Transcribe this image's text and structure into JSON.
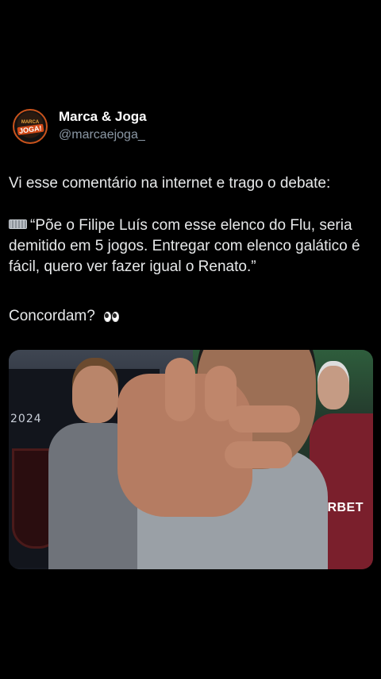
{
  "account": {
    "display_name": "Marca & Joga",
    "handle": "@marcaejoga_",
    "avatar_text_top": "MARCA",
    "avatar_text_main": "JOGA!"
  },
  "post": {
    "line1": "Vi esse comentário na internet e trago o debate:",
    "quote": "“Põe o Filipe Luís com esse elenco do Flu, seria demitido em 5 jogos. Entregar com elenco galático é fácil, quero ver fazer igual o Renato.”",
    "question": "Concordam?"
  },
  "media": {
    "year_label": "2024",
    "sponsor_text": "ERBET"
  },
  "icons": {
    "keyboard": "keyboard-icon",
    "eyes": "eyes-emoji-icon"
  },
  "colors": {
    "background": "#000000",
    "text": "#e7e9ea",
    "handle": "#8b98a5",
    "avatar_ring": "#c9531c"
  }
}
